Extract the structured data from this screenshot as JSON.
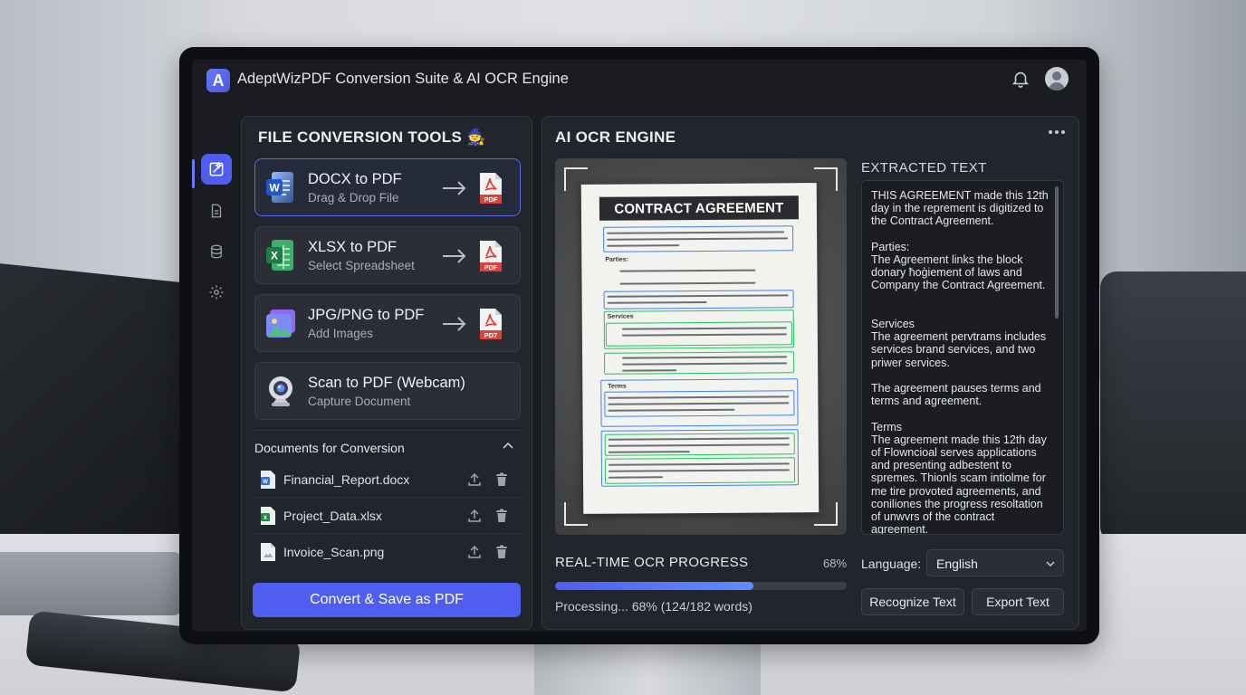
{
  "app": {
    "title": "AdeptWizPDF Conversion Suite & AI OCR Engine",
    "logo_letter": "A"
  },
  "tools": {
    "heading": "FILE CONVERSION TOOLS 🧙",
    "cards": [
      {
        "title": "DOCX to PDF",
        "subtitle": "Drag & Drop File",
        "icon": "word-icon"
      },
      {
        "title": "XLSX to PDF",
        "subtitle": "Select Spreadsheet",
        "icon": "excel-icon"
      },
      {
        "title": "JPG/PNG to PDF",
        "subtitle": "Add Images",
        "icon": "image-icon"
      },
      {
        "title": "Scan to PDF (Webcam)",
        "subtitle": "Capture Document",
        "icon": "webcam-icon"
      }
    ],
    "pdf_badge": "PDF",
    "pdf_badge_alt": "PD7"
  },
  "documents": {
    "heading": "Documents for Conversion",
    "files": [
      {
        "name": "Financial_Report.docx",
        "type": "docx"
      },
      {
        "name": "Project_Data.xlsx",
        "type": "xlsx"
      },
      {
        "name": "Invoice_Scan.png",
        "type": "png"
      }
    ],
    "convert_label": "Convert & Save as PDF"
  },
  "ocr": {
    "heading": "AI OCR ENGINE",
    "preview": {
      "paper_title": "CONTRACT AGREEMENT",
      "labels": [
        "Parties:",
        "Services",
        "Terms"
      ]
    },
    "extracted": {
      "heading": "EXTRACTED TEXT",
      "text": "THIS AGREEMENT made this 12th day in the reprement is digitized to the Contract Agreement.\n\nParties:\nThe Agreement links the block donary ħoģiement of laws and Company the Contract Agreement.\n\n\nServices\nThe agreement pervtrams includes services brand services, and two priwer services.\n\nThe agreement pauses terms and terms and agreement.\n\nTerms\nThe agreement made this 12th day of Flowncioal serves applications and presenting adbestent to spremes. Thionls scam intiolme for me tire provoted agreements, and coniliones the progress resoltation of unwvrs of the contract agreement."
    },
    "progress": {
      "heading": "REAL-TIME OCR PROGRESS",
      "percent_label": "68%",
      "fraction": 0.68,
      "status": "Processing... 68% (124/182 words)"
    },
    "language": {
      "label": "Language:",
      "value": "English"
    },
    "buttons": {
      "recognize": "Recognize Text",
      "export": "Export Text"
    }
  },
  "colors": {
    "accent": "#4f5ef0",
    "ocr_blue": "#3b82f6",
    "ocr_green": "#22c55e",
    "pdf_red": "#e0413a"
  }
}
